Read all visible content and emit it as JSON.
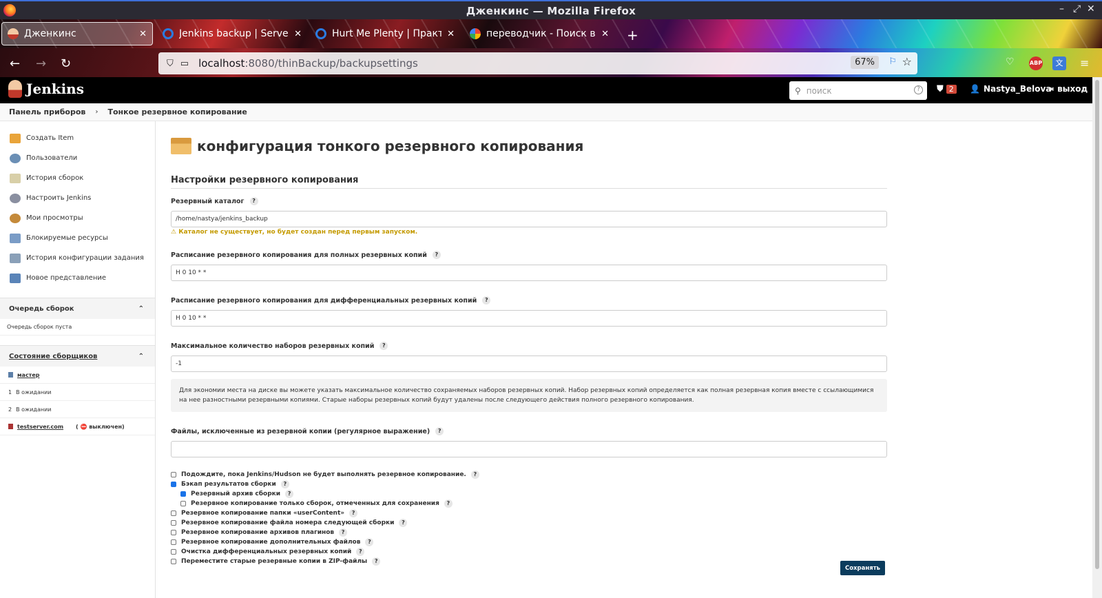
{
  "window": {
    "title": "Дженкинс — Mozilla Firefox"
  },
  "tabs": [
    {
      "label": "Дженкинс",
      "active": true
    },
    {
      "label": "Jenkins backup | Server a",
      "active": false
    },
    {
      "label": "Hurt Me Plenty | Практи",
      "active": false
    },
    {
      "label": "переводчик - Поиск в G",
      "active": false
    }
  ],
  "address": {
    "host": "localhost",
    "path": ":8080/thinBackup/backupsettings",
    "zoom": "67%"
  },
  "jenkins": {
    "brand": "Jenkins",
    "search_placeholder": "поиск",
    "alerts_count": "2",
    "user": "Nastya_Belova",
    "logout": "выход"
  },
  "breadcrumbs": [
    "Панель приборов",
    "Тонкое резервное копирование"
  ],
  "sidebar": {
    "tasks": [
      {
        "label": "Создать Item"
      },
      {
        "label": "Пользователи"
      },
      {
        "label": "История сборок"
      },
      {
        "label": "Настроить Jenkins"
      },
      {
        "label": "Мои просмотры"
      },
      {
        "label": "Блокируемые ресурсы"
      },
      {
        "label": "История конфигурации задания"
      },
      {
        "label": "Новое представление"
      }
    ],
    "queue_title": "Очередь сборок",
    "queue_empty": "Очередь сборок пуста",
    "executors_title": "Состояние сборщиков",
    "master": "мастер",
    "executors": [
      {
        "num": "1",
        "state": "В ожидании"
      },
      {
        "num": "2",
        "state": "В ожидании"
      }
    ],
    "agent": "testserver.com",
    "agent_state": "( ⛔ выключен)"
  },
  "page": {
    "title": "конфигурация тонкого резервного копирования",
    "section": "Настройки резервного копирования",
    "backup_dir_label": "Резервный каталог",
    "backup_dir_value": "/home/nastya/jenkins_backup",
    "backup_dir_warning": "⚠ Каталог не существует, но будет создан перед первым запуском.",
    "full_schedule_label": "Расписание резервного копирования для полных резервных копий",
    "full_schedule_value": "H 0 10 * *",
    "diff_schedule_label": "Расписание резервного копирования для дифференциальных резервных копий",
    "diff_schedule_value": "H 0 10 * *",
    "max_sets_label": "Максимальное количество наборов резервных копий",
    "max_sets_value": "-1",
    "max_sets_help": "Для экономии места на диске вы можете указать максимальное количество сохраняемых наборов резервных копий. Набор резервных копий определяется как полная резервная копия вместе с ссылающимися на нее разностными резервными копиями. Старые наборы резервных копий будут удалены после следующего действия полного резервного копирования.",
    "exclude_label": "Файлы, исключенные из резервной копии (регулярное выражение)",
    "exclude_value": "",
    "options": [
      {
        "label": "Подождите, пока Jenkins/Hudson не будет выполнять резервное копирование.",
        "checked": false,
        "indent": 0
      },
      {
        "label": "Бэкап результатов сборки",
        "checked": true,
        "indent": 0
      },
      {
        "label": "Резервный архив сборки",
        "checked": true,
        "indent": 1
      },
      {
        "label": "Резервное копирование только сборок, отмеченных для сохранения",
        "checked": false,
        "indent": 1
      },
      {
        "label": "Резервное копирование папки «userContent»",
        "checked": false,
        "indent": 0
      },
      {
        "label": "Резервное копирование файла номера следующей сборки",
        "checked": false,
        "indent": 0
      },
      {
        "label": "Резервное копирование архивов плагинов",
        "checked": false,
        "indent": 0
      },
      {
        "label": "Резервное копирование дополнительных файлов",
        "checked": false,
        "indent": 0
      },
      {
        "label": "Очистка дифференциальных резервных копий",
        "checked": false,
        "indent": 0
      },
      {
        "label": "Переместите старые резервные копии в ZIP-файлы",
        "checked": false,
        "indent": 0
      }
    ],
    "save_button": "Сохранять"
  }
}
